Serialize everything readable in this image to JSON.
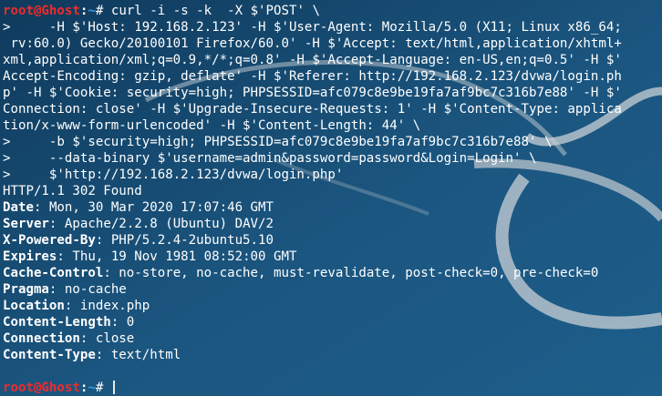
{
  "colors": {
    "background": "#1a4f76",
    "prompt_user": "#ef2b2b",
    "prompt_path": "#3b9ae1",
    "text": "#ffffff"
  },
  "background_logo_icon": "kali-dragon-icon",
  "prompt": {
    "user_host": "root@Ghost",
    "colon": ":",
    "path": "~",
    "symbol": "# "
  },
  "command_lines": [
    "curl -i -s -k  -X $'POST' \\",
    ">     -H $'Host: 192.168.2.123' -H $'User-Agent: Mozilla/5.0 (X11; Linux x86_64;",
    " rv:60.0) Gecko/20100101 Firefox/60.0' -H $'Accept: text/html,application/xhtml+",
    "xml,application/xml;q=0.9,*/*;q=0.8' -H $'Accept-Language: en-US,en;q=0.5' -H $'",
    "Accept-Encoding: gzip, deflate' -H $'Referer: http://192.168.2.123/dvwa/login.ph",
    "p' -H $'Cookie: security=high; PHPSESSID=afc079c8e9be19fa7af9bc7c316b7e88' -H $'",
    "Connection: close' -H $'Upgrade-Insecure-Requests: 1' -H $'Content-Type: applica",
    "tion/x-www-form-urlencoded' -H $'Content-Length: 44' \\",
    ">     -b $'security=high; PHPSESSID=afc079c8e9be19fa7af9bc7c316b7e88' \\",
    ">     --data-binary $'username=admin&password=password&Login=Login' \\",
    ">     $'http://192.168.2.123/dvwa/login.php'"
  ],
  "response": {
    "status_line": "HTTP/1.1 302 Found",
    "headers": [
      {
        "name": "Date",
        "value": " Mon, 30 Mar 2020 17:07:46 GMT"
      },
      {
        "name": "Server",
        "value": " Apache/2.2.8 (Ubuntu) DAV/2"
      },
      {
        "name": "X-Powered-By",
        "value": " PHP/5.2.4-2ubuntu5.10"
      },
      {
        "name": "Expires",
        "value": " Thu, 19 Nov 1981 08:52:00 GMT"
      },
      {
        "name": "Cache-Control",
        "value": " no-store, no-cache, must-revalidate, post-check=0, pre-check=0"
      },
      {
        "name": "Pragma",
        "value": " no-cache"
      },
      {
        "name": "Location",
        "value": " index.php"
      },
      {
        "name": "Content-Length",
        "value": " 0"
      },
      {
        "name": "Connection",
        "value": " close"
      },
      {
        "name": "Content-Type",
        "value": " text/html"
      }
    ]
  },
  "input": {
    "value": ""
  }
}
